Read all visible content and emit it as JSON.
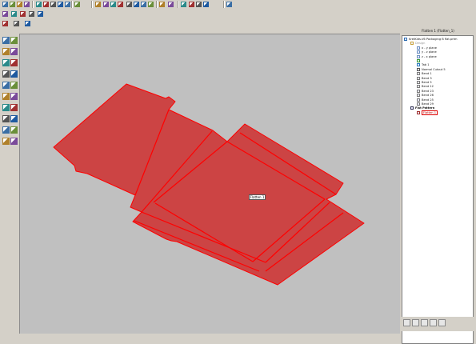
{
  "toolbar": {
    "row1_icons": [
      "new-doc-icon",
      "open-folder-icon",
      "save-icon",
      "print-icon",
      "cut-icon",
      "copy-icon",
      "paste-icon",
      "delete-icon",
      "undo-icon",
      "redo-icon",
      "select-icon",
      "model-icon",
      "regen-icon",
      "datum-plane-icon",
      "datum-axis-icon",
      "datum-point-icon",
      "csys-icon",
      "appearance-icon",
      "view-icon",
      "orient-icon",
      "refit-icon",
      "zoom-in-icon",
      "zoom-out-icon",
      "repaint-icon",
      "help-icon"
    ],
    "row2_icons": [
      "wireframe-icon",
      "hidden-line-icon",
      "shaded-icon",
      "sketch-icon",
      "spin-center-icon"
    ],
    "row3_icons": [
      "window-icon",
      "close-window-icon",
      "activate-icon"
    ]
  },
  "left_toolbar": {
    "icons": [
      "pointer-icon",
      "sheet-wall-icon",
      "flat-wall-icon",
      "extend-icon",
      "flange-icon",
      "unbend-icon",
      "bend-back-icon",
      "cut-icon",
      "punch-icon",
      "notch-icon",
      "rip-icon",
      "merge-icon",
      "deform-icon",
      "form-icon",
      "bend-icon",
      "edge-bend-icon",
      "corner-relief-icon",
      "conversion-icon",
      "flat-pattern-icon",
      "datum-plane-icon"
    ]
  },
  "graphics": {
    "part_color": "#cc4444",
    "part_edge_color": "#ff0000",
    "background_color": "#c0c0c0",
    "feature_label": "Flatten 1"
  },
  "model_tree": {
    "title": "Flatten 1 (Flatten_1)",
    "items": [
      {
        "label": "KretKids-V6 Packaging B flat.prtm",
        "icon": "part-icon",
        "indent": 0
      },
      {
        "label": "Design",
        "icon": "folder-icon",
        "indent": 1
      },
      {
        "label": "x - y plane",
        "icon": "datum-plane-icon",
        "indent": 2
      },
      {
        "label": "y - z plane",
        "icon": "datum-plane-icon",
        "indent": 2
      },
      {
        "label": "z - x plane",
        "icon": "datum-plane-icon",
        "indent": 2
      },
      {
        "label": "",
        "icon": "sketch-icon",
        "indent": 2
      },
      {
        "label": "Tab 1",
        "icon": "tab-icon",
        "indent": 2
      },
      {
        "label": "Normal Cutout 5",
        "icon": "cutout-icon",
        "indent": 2
      },
      {
        "label": "Bend 1",
        "icon": "bend-icon",
        "indent": 2
      },
      {
        "label": "Bend 3",
        "icon": "bend-icon",
        "indent": 2
      },
      {
        "label": "Bend 5",
        "icon": "bend-icon",
        "indent": 2
      },
      {
        "label": "Bend 12",
        "icon": "bend-icon",
        "indent": 2
      },
      {
        "label": "Bend 23",
        "icon": "bend-icon",
        "indent": 2
      },
      {
        "label": "Bend 26",
        "icon": "bend-icon",
        "indent": 2
      },
      {
        "label": "Bend 25",
        "icon": "bend-icon",
        "indent": 2
      },
      {
        "label": "Bend 29",
        "icon": "bend-icon",
        "indent": 2
      },
      {
        "label": "Flat Pattern",
        "icon": "flat-pattern-icon",
        "indent": 1
      },
      {
        "label": "Flatten 1",
        "icon": "flatten-icon",
        "indent": 2
      }
    ],
    "selected": "Flatten 1"
  },
  "tree_bottom_bar": {
    "icons": [
      "feature-tree-icon",
      "layers-icon",
      "properties-icon",
      "display-icon",
      "settings-icon"
    ]
  }
}
